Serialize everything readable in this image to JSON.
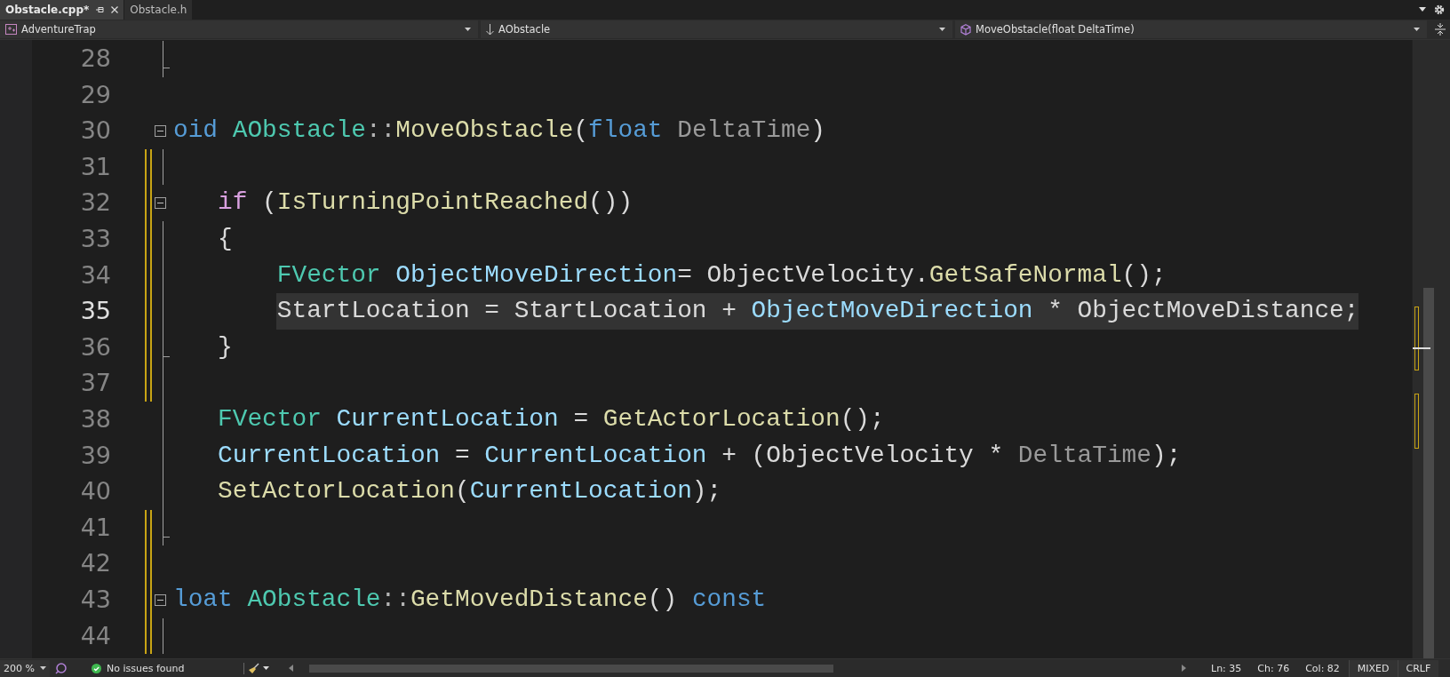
{
  "tabs": [
    {
      "label": "Obstacle.cpp*",
      "selected": true
    },
    {
      "label": "Obstacle.h",
      "selected": false
    }
  ],
  "navigation_bar": {
    "project": "AdventureTrap",
    "class": "AObstacle",
    "member": "MoveObstacle(float DeltaTime)"
  },
  "code_lines": [
    {
      "number": "28",
      "kind": "end",
      "current": false,
      "modified": false,
      "highlighted": false
    },
    {
      "number": "29",
      "kind": "none",
      "current": false,
      "modified": false,
      "highlighted": false
    },
    {
      "number": "30",
      "kind": "start",
      "current": false,
      "modified": false,
      "highlighted": false,
      "tokens": [
        {
          "kind": "kw",
          "text": "oid "
        },
        {
          "kind": "type",
          "text": "AObstacle"
        },
        {
          "kind": "op",
          "text": "::"
        },
        {
          "kind": "fn",
          "text": "MoveObstacle"
        },
        {
          "kind": "plain",
          "text": "("
        },
        {
          "kind": "kw",
          "text": "float "
        },
        {
          "kind": "param",
          "text": "DeltaTime"
        },
        {
          "kind": "plain",
          "text": ")"
        }
      ]
    },
    {
      "number": "31",
      "kind": "body",
      "current": false,
      "modified": true,
      "highlighted": false
    },
    {
      "number": "32",
      "kind": "start",
      "current": false,
      "modified": true,
      "highlighted": false,
      "tokens": [
        {
          "kind": "ctrl",
          "text": "   if"
        },
        {
          "kind": "plain",
          "text": " ("
        },
        {
          "kind": "fn",
          "text": "IsTurningPointReached"
        },
        {
          "kind": "plain",
          "text": "())"
        }
      ]
    },
    {
      "number": "33",
      "kind": "body",
      "current": false,
      "modified": true,
      "highlighted": false,
      "tokens": [
        {
          "kind": "plain",
          "text": "   {"
        }
      ]
    },
    {
      "number": "34",
      "kind": "body",
      "current": false,
      "modified": true,
      "highlighted": false,
      "tokens": [
        {
          "kind": "type",
          "text": "       FVector "
        },
        {
          "kind": "local",
          "text": "ObjectMoveDirection"
        },
        {
          "kind": "plain",
          "text": "= ObjectVelocity."
        },
        {
          "kind": "fn",
          "text": "GetSafeNormal"
        },
        {
          "kind": "plain",
          "text": "();"
        }
      ]
    },
    {
      "number": "35",
      "kind": "body",
      "current": true,
      "modified": true,
      "highlighted": true,
      "tokens": [
        {
          "kind": "plain",
          "text": "       StartLocation = StartLocation + "
        },
        {
          "kind": "local",
          "text": "ObjectMoveDirection"
        },
        {
          "kind": "plain",
          "text": " * ObjectMoveDistance;"
        }
      ]
    },
    {
      "number": "36",
      "kind": "end",
      "current": false,
      "modified": true,
      "highlighted": false,
      "tokens": [
        {
          "kind": "plain",
          "text": "   }"
        }
      ]
    },
    {
      "number": "37",
      "kind": "body",
      "current": false,
      "modified": true,
      "highlighted": false
    },
    {
      "number": "38",
      "kind": "body",
      "current": false,
      "modified": false,
      "highlighted": false,
      "tokens": [
        {
          "kind": "type",
          "text": "   FVector "
        },
        {
          "kind": "local",
          "text": "CurrentLocation"
        },
        {
          "kind": "plain",
          "text": " = "
        },
        {
          "kind": "fn",
          "text": "GetActorLocation"
        },
        {
          "kind": "plain",
          "text": "();"
        }
      ]
    },
    {
      "number": "39",
      "kind": "body",
      "current": false,
      "modified": false,
      "highlighted": false,
      "tokens": [
        {
          "kind": "local",
          "text": "   CurrentLocation"
        },
        {
          "kind": "plain",
          "text": " = "
        },
        {
          "kind": "local",
          "text": "CurrentLocation"
        },
        {
          "kind": "plain",
          "text": " + (ObjectVelocity * "
        },
        {
          "kind": "param",
          "text": "DeltaTime"
        },
        {
          "kind": "plain",
          "text": ");"
        }
      ]
    },
    {
      "number": "40",
      "kind": "body",
      "current": false,
      "modified": false,
      "highlighted": false,
      "tokens": [
        {
          "kind": "fn",
          "text": "   SetActorLocation"
        },
        {
          "kind": "plain",
          "text": "("
        },
        {
          "kind": "local",
          "text": "CurrentLocation"
        },
        {
          "kind": "plain",
          "text": ");"
        }
      ]
    },
    {
      "number": "41",
      "kind": "end",
      "current": false,
      "modified": true,
      "highlighted": false
    },
    {
      "number": "42",
      "kind": "none",
      "current": false,
      "modified": true,
      "highlighted": false
    },
    {
      "number": "43",
      "kind": "start",
      "current": false,
      "modified": true,
      "highlighted": false,
      "tokens": [
        {
          "kind": "kw",
          "text": "loat "
        },
        {
          "kind": "type",
          "text": "AObstacle"
        },
        {
          "kind": "op",
          "text": "::"
        },
        {
          "kind": "fn",
          "text": "GetMovedDistance"
        },
        {
          "kind": "plain",
          "text": "() "
        },
        {
          "kind": "kw",
          "text": "const"
        }
      ]
    },
    {
      "number": "44",
      "kind": "body",
      "current": false,
      "modified": true,
      "highlighted": false
    }
  ],
  "status_bar": {
    "zoom": "200 %",
    "issues": "No issues found",
    "line": "Ln: 35",
    "char": "Ch: 76",
    "column": "Col: 82",
    "whitespace": "MIXED",
    "line_endings": "CRLF"
  }
}
